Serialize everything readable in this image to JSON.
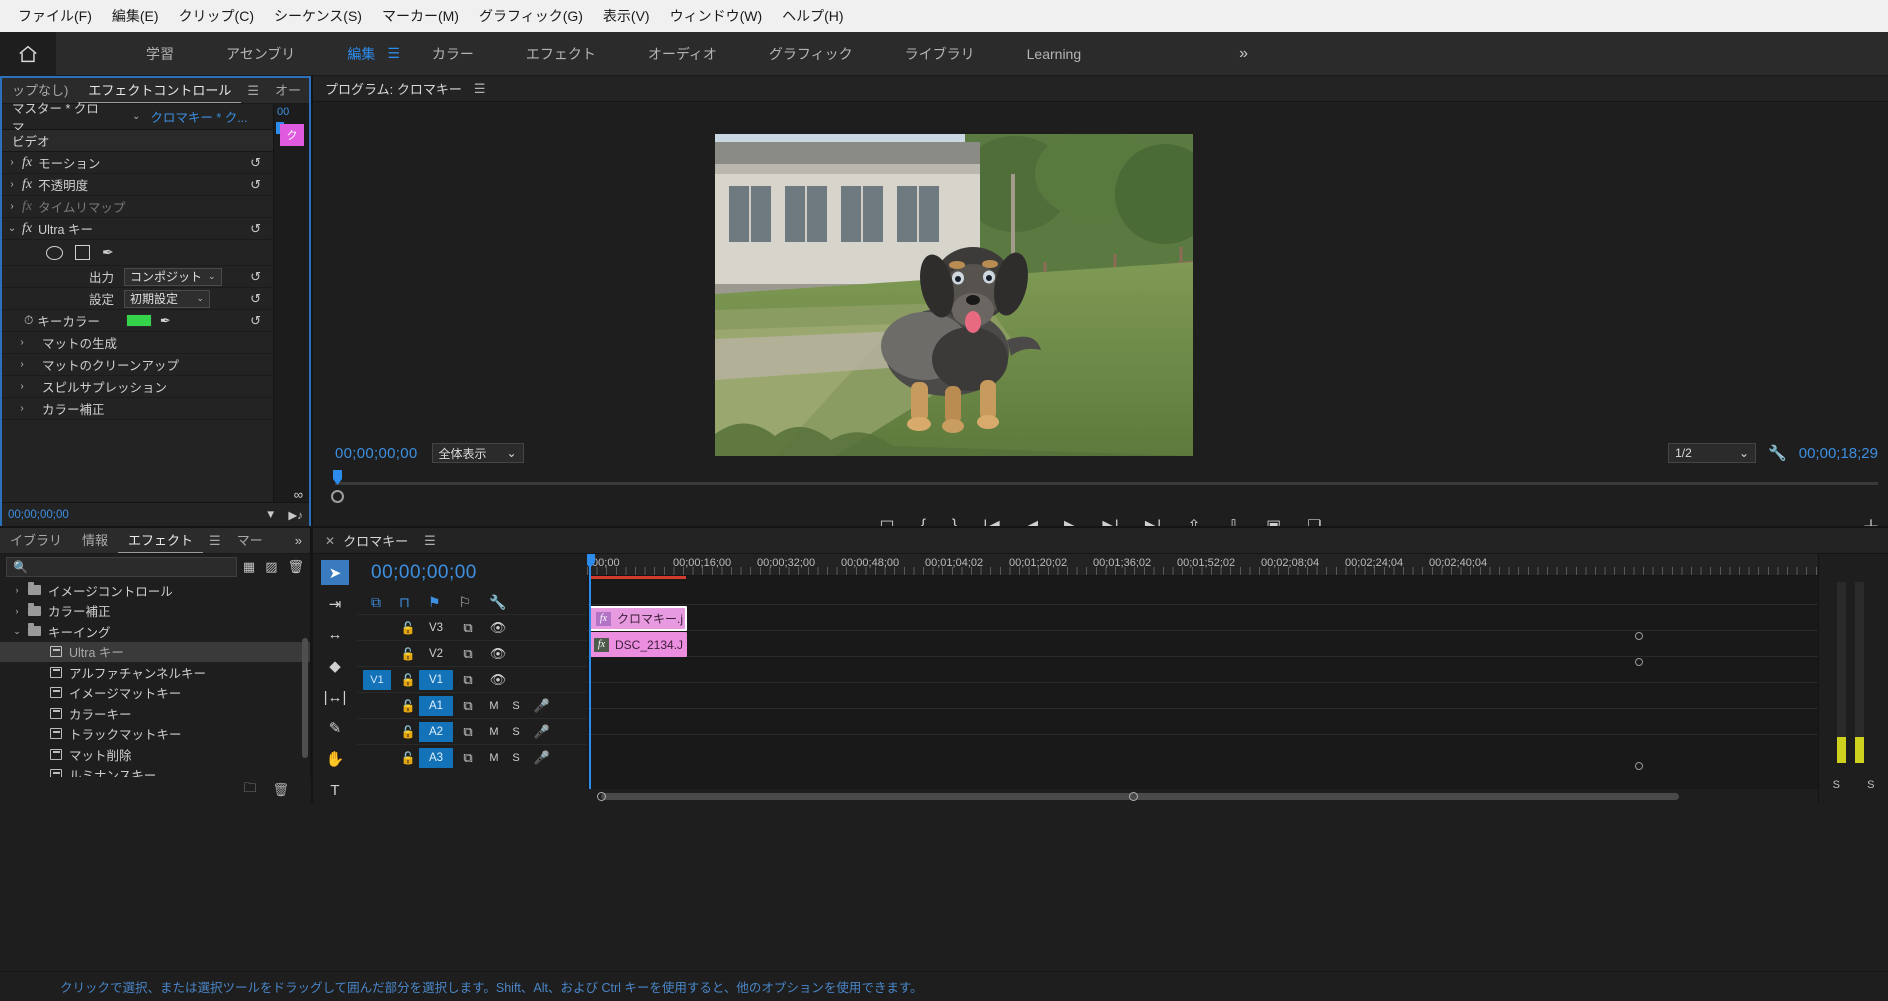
{
  "menubar": {
    "items": [
      "ファイル(F)",
      "編集(E)",
      "クリップ(C)",
      "シーケンス(S)",
      "マーカー(M)",
      "グラフィック(G)",
      "表示(V)",
      "ウィンドウ(W)",
      "ヘルプ(H)"
    ]
  },
  "workspace": {
    "home_icon": "home-icon",
    "tabs": [
      {
        "label": "学習",
        "active": false
      },
      {
        "label": "アセンブリ",
        "active": false
      },
      {
        "label": "編集",
        "active": true
      },
      {
        "label": "カラー",
        "active": false
      },
      {
        "label": "エフェクト",
        "active": false
      },
      {
        "label": "オーディオ",
        "active": false
      },
      {
        "label": "グラフィック",
        "active": false
      },
      {
        "label": "ライブラリ",
        "active": false
      },
      {
        "label": "Learning",
        "active": false
      }
    ],
    "overflow": "»"
  },
  "effect_controls": {
    "tabs": [
      {
        "label": "ップなし)",
        "active": false
      },
      {
        "label": "エフェクトコントロール",
        "active": true
      },
      {
        "label": "オー",
        "active": false
      }
    ],
    "overflow": "»",
    "master_label": "マスター * クロマ...",
    "clip_label": "クロマキー * ク...",
    "section_video": "ビデオ",
    "rows": [
      {
        "name": "モーション",
        "fx": true,
        "dim": false,
        "arrow": "›"
      },
      {
        "name": "不透明度",
        "fx": true,
        "dim": false,
        "arrow": "›"
      },
      {
        "name": "タイムリマップ",
        "fx": true,
        "dim": true,
        "arrow": "›"
      },
      {
        "name": "Ultra キー",
        "fx": true,
        "dim": false,
        "arrow": "⌄"
      }
    ],
    "ultra_key": {
      "shape_tools": [
        "ellipse-mask-icon",
        "rectangle-mask-icon",
        "pen-mask-icon"
      ],
      "params": [
        {
          "label": "出力",
          "value": "コンポジット",
          "type": "select"
        },
        {
          "label": "設定",
          "value": "初期設定",
          "type": "select"
        }
      ],
      "key_color": {
        "label": "キーカラー",
        "color": "#34d34b",
        "eyedropper": "eyedropper-icon"
      },
      "groups": [
        "マットの生成",
        "マットのクリーンアップ",
        "スピルサプレッション",
        "カラー補正"
      ]
    },
    "timecode_footer": "00;00;00;00",
    "mini_timeline": {
      "timecode": "00",
      "marker_label": "ク"
    }
  },
  "effects_panel": {
    "tabs": [
      {
        "label": "イブラリ",
        "active": false
      },
      {
        "label": "情報",
        "active": false
      },
      {
        "label": "エフェクト",
        "active": true
      },
      {
        "label": "マー",
        "active": false
      }
    ],
    "overflow": "»",
    "search_placeholder": "",
    "search_icon": "search-icon",
    "header_icons": [
      "accelerated-effects-icon",
      "32bit-color-icon",
      "trash-icon"
    ],
    "tree": [
      {
        "label": "イメージコントロール",
        "type": "folder",
        "depth": 1,
        "expanded": false,
        "selected": false
      },
      {
        "label": "カラー補正",
        "type": "folder",
        "depth": 1,
        "expanded": false,
        "selected": false
      },
      {
        "label": "キーイング",
        "type": "folder",
        "depth": 1,
        "expanded": true,
        "selected": false
      },
      {
        "label": "Ultra キー",
        "type": "effect",
        "depth": 2,
        "expanded": false,
        "selected": true
      },
      {
        "label": "アルファチャンネルキー",
        "type": "effect",
        "depth": 2,
        "expanded": false,
        "selected": false
      },
      {
        "label": "イメージマットキー",
        "type": "effect",
        "depth": 2,
        "expanded": false,
        "selected": false
      },
      {
        "label": "カラーキー",
        "type": "effect",
        "depth": 2,
        "expanded": false,
        "selected": false
      },
      {
        "label": "トラックマットキー",
        "type": "effect",
        "depth": 2,
        "expanded": false,
        "selected": false
      },
      {
        "label": "マット削除",
        "type": "effect",
        "depth": 2,
        "expanded": false,
        "selected": false
      },
      {
        "label": "ルミナンスキー",
        "type": "effect",
        "depth": 2,
        "expanded": false,
        "selected": false
      }
    ],
    "footer_icons": [
      "new-bin-icon",
      "delete-icon"
    ]
  },
  "program_monitor": {
    "title": "プログラム: クロマキー",
    "menu_icon": "panel-menu-icon",
    "timecode_left": "00;00;00;00",
    "fit_select": "全体表示",
    "zoom_select": "1/2",
    "wrench_icon": "settings-wrench-icon",
    "timecode_right": "00;00;18;29",
    "transport_icons": [
      "add-marker-icon",
      "mark-in-icon",
      "mark-out-icon",
      "go-to-in-icon",
      "step-back-icon",
      "play-icon",
      "step-forward-icon",
      "go-to-out-icon",
      "lift-icon",
      "extract-icon",
      "export-frame-icon",
      "comparison-view-icon"
    ],
    "plus_icon": "button-editor-icon"
  },
  "timeline": {
    "tab_label": "クロマキー",
    "close_icon": "close-icon",
    "menu_icon": "panel-menu-icon",
    "timecode": "00;00;00;00",
    "header_icons": [
      "nest-icon",
      "snap-magnet-icon",
      "linked-selection-icon",
      "add-marker-icon",
      "timeline-settings-icon"
    ],
    "ruler_labels": [
      ";00;00",
      "00;00;16;00",
      "00;00;32;00",
      "00;00;48;00",
      "00;01;04;02",
      "00;01;20;02",
      "00;01;36;02",
      "00;01;52;02",
      "00;02;08;04",
      "00;02;24;04",
      "00;02;40;04"
    ],
    "tracks": [
      {
        "name": "V3",
        "kind": "video",
        "source": "",
        "lock": "lock-icon",
        "sync": "sync-lock-icon",
        "eye": "eye-icon",
        "highlight": false
      },
      {
        "name": "V2",
        "kind": "video",
        "source": "",
        "lock": "lock-icon",
        "sync": "sync-lock-icon",
        "eye": "eye-icon",
        "highlight": false
      },
      {
        "name": "V1",
        "kind": "video",
        "source": "V1",
        "lock": "lock-icon",
        "sync": "sync-lock-icon",
        "eye": "eye-icon",
        "highlight": true
      },
      {
        "name": "A1",
        "kind": "audio",
        "source": "",
        "lock": "lock-icon",
        "sync": "sync-lock-icon",
        "mute": "M",
        "solo": "S",
        "mic": "mic-icon",
        "highlight": true
      },
      {
        "name": "A2",
        "kind": "audio",
        "source": "",
        "lock": "lock-icon",
        "sync": "sync-lock-icon",
        "mute": "M",
        "solo": "S",
        "mic": "mic-icon",
        "highlight": true
      },
      {
        "name": "A3",
        "kind": "audio",
        "source": "",
        "lock": "lock-icon",
        "sync": "sync-lock-icon",
        "mute": "M",
        "solo": "S",
        "mic": "mic-icon",
        "highlight": true
      }
    ],
    "clips": [
      {
        "name": "クロマキー.j",
        "track": "V2",
        "fx_badge": "fx",
        "color": "#e89ae0",
        "selected": true
      },
      {
        "name": "DSC_2134.J",
        "track": "V1",
        "fx_badge": "fx",
        "color": "#ec8ee0",
        "selected": false
      }
    ],
    "tools": [
      {
        "name": "selection-tool",
        "glyph": "➤",
        "active": true
      },
      {
        "name": "track-select-forward-tool",
        "glyph": "⇥",
        "active": false
      },
      {
        "name": "ripple-edit-tool",
        "glyph": "↔",
        "active": false
      },
      {
        "name": "rate-stretch-tool",
        "glyph": "◆",
        "active": false
      },
      {
        "name": "slip-tool",
        "glyph": "|↔|",
        "active": false
      },
      {
        "name": "pen-tool",
        "glyph": "✎",
        "active": false
      },
      {
        "name": "hand-tool",
        "glyph": "✋",
        "active": false
      },
      {
        "name": "type-tool",
        "glyph": "T",
        "active": false
      }
    ],
    "audio_meter_labels": [
      "S",
      "S"
    ]
  },
  "statusbar": {
    "message": "クリックで選択、または選択ツールをドラッグして囲んだ部分を選択します。Shift、Alt、および Ctrl キーを使用すると、他のオプションを使用できます。"
  },
  "colors": {
    "accent_blue": "#2d8ceb",
    "key_green": "#34d34b",
    "clip_pink": "#ec8ee0",
    "work_bar_red": "#d23b2e"
  }
}
